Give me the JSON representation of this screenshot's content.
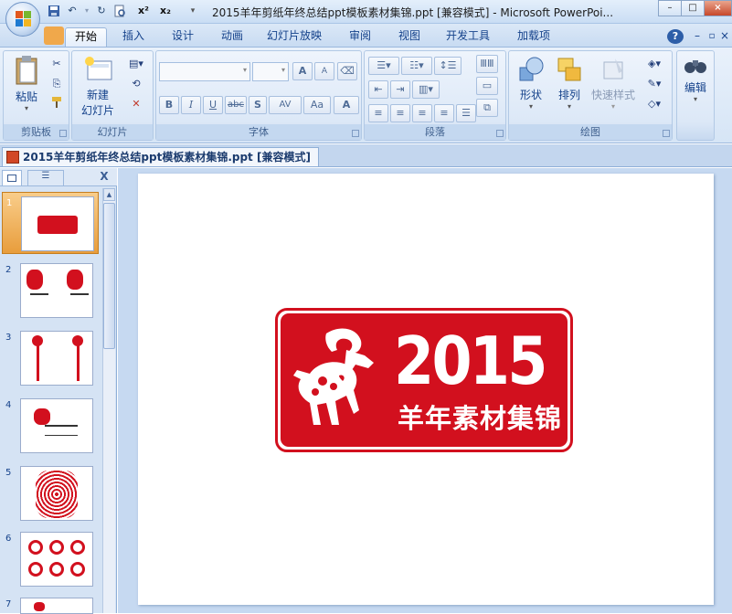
{
  "window": {
    "title": "2015羊年剪纸年终总结ppt模板素材集锦.ppt [兼容模式] - Microsoft PowerPoi...",
    "minimize": "–",
    "restore": "□",
    "close": "×"
  },
  "quick_access": {
    "superscript": "x²",
    "subscript": "x₂"
  },
  "tabs": [
    "开始",
    "插入",
    "设计",
    "动画",
    "幻灯片放映",
    "审阅",
    "视图",
    "开发工具",
    "加载项"
  ],
  "ribbon": {
    "clipboard": {
      "paste": "粘贴",
      "label": "剪贴板"
    },
    "slides": {
      "new_slide_line1": "新建",
      "new_slide_line2": "幻灯片",
      "label": "幻灯片"
    },
    "font": {
      "bold": "B",
      "italic": "I",
      "underline": "U",
      "strike": "abc",
      "shadow": "S",
      "spacing": "AV",
      "case": "Aa",
      "color": "A",
      "grow": "A",
      "shrink": "A",
      "label": "字体"
    },
    "paragraph": {
      "label": "段落"
    },
    "drawing": {
      "shapes": "形状",
      "arrange": "排列",
      "quick_styles": "快速样式",
      "label": "绘图"
    },
    "editing": {
      "label": "编辑"
    }
  },
  "document_tab": "2015羊年剪纸年终总结ppt模板素材集锦.ppt [兼容模式]",
  "panel": {
    "close": "X"
  },
  "thumbnails": [
    "1",
    "2",
    "3",
    "4",
    "5",
    "6",
    "7"
  ],
  "slide": {
    "year": "2015",
    "subtitle": "羊年素材集锦"
  },
  "colors": {
    "accent": "#d2101e",
    "ribbon": "#dce8f7",
    "workspace": "#c6d9f1"
  }
}
